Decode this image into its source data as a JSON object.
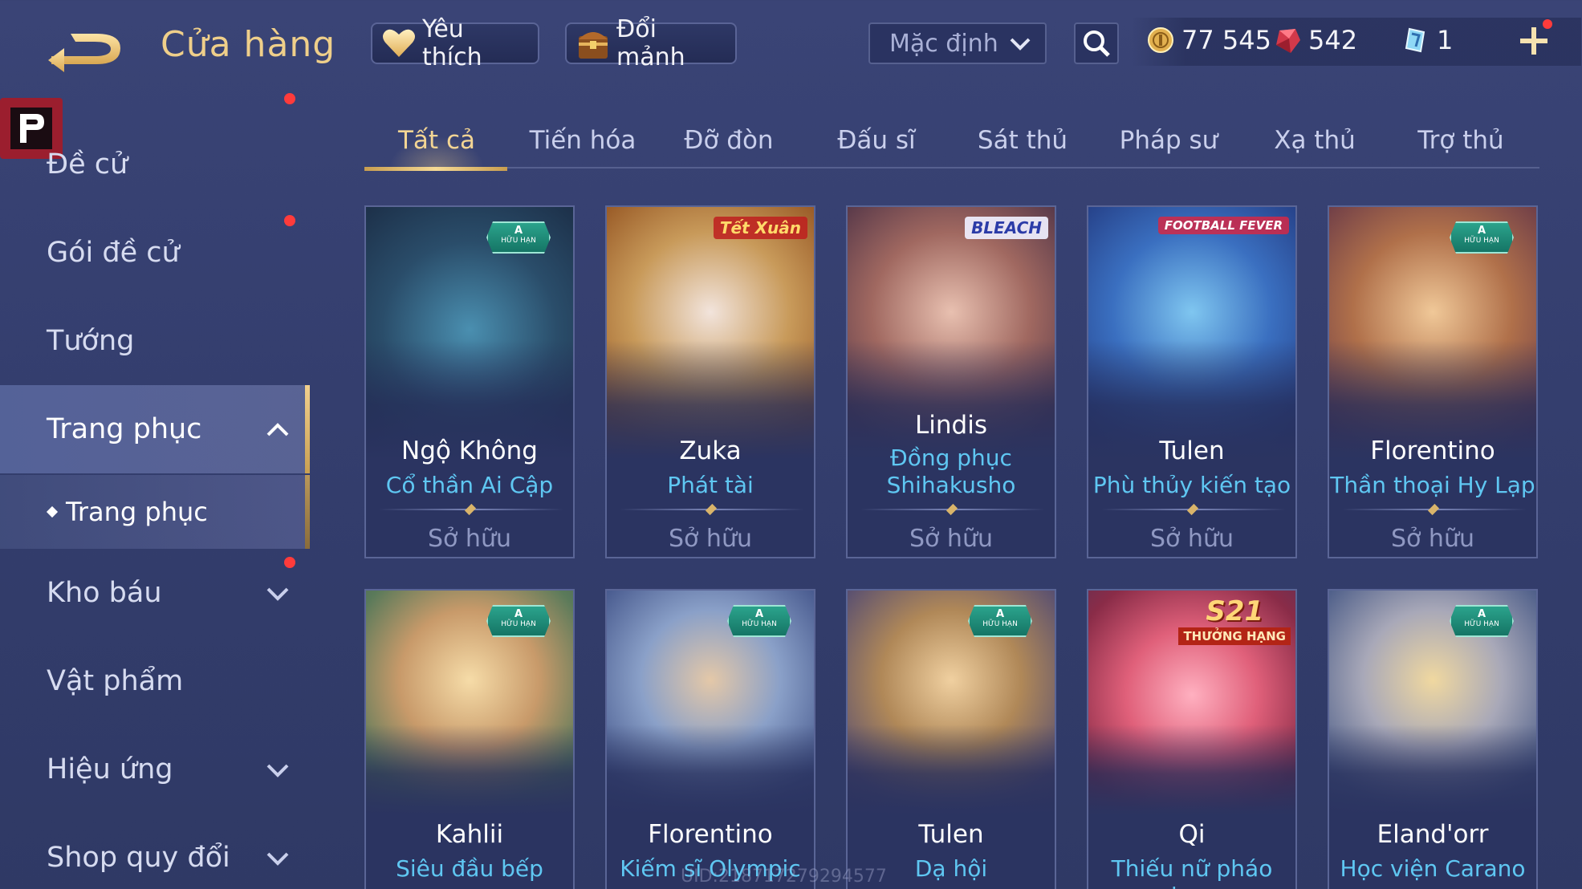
{
  "header": {
    "title": "Cửa hàng",
    "favorites_label": "Yêu thích",
    "swap_label": "Đổi mảnh",
    "sort_value": "Mặc định"
  },
  "currency": {
    "gold": "77 545",
    "ruby": "542",
    "ticket": "1"
  },
  "sidebar": {
    "items": [
      {
        "label": "Đề cử"
      },
      {
        "label": "Gói đề cử"
      },
      {
        "label": "Tướng"
      },
      {
        "label": "Trang phục"
      },
      {
        "label": "Trang phục"
      },
      {
        "label": "Kho báu"
      },
      {
        "label": "Vật phẩm"
      },
      {
        "label": "Hiệu ứng"
      },
      {
        "label": "Shop quy đổi"
      }
    ]
  },
  "tabs": [
    {
      "label": "Tất cả"
    },
    {
      "label": "Tiến hóa"
    },
    {
      "label": "Đỡ đòn"
    },
    {
      "label": "Đấu sĩ"
    },
    {
      "label": "Sát thủ"
    },
    {
      "label": "Pháp sư"
    },
    {
      "label": "Xạ thủ"
    },
    {
      "label": "Trợ thủ"
    }
  ],
  "badges": {
    "limited_tier": "A",
    "limited_label": "HỮU HẠN",
    "tet_label": "Tết Xuân",
    "bleach_label": "BLEACH",
    "football_label": "FOOTBALL FEVER",
    "season_label": "S21",
    "rank_label": "THƯỞNG HẠNG"
  },
  "cards": [
    {
      "hero": "Ngộ Không",
      "skin": "Cổ thần Ai Cập",
      "status": "Sở hữu"
    },
    {
      "hero": "Zuka",
      "skin": "Phát tài",
      "status": "Sở hữu"
    },
    {
      "hero": "Lindis",
      "skin": "Đồng phục Shihakusho",
      "status": "Sở hữu"
    },
    {
      "hero": "Tulen",
      "skin": "Phù thủy kiến tạo",
      "status": "Sở hữu"
    },
    {
      "hero": "Florentino",
      "skin": "Thần thoại Hy Lạp",
      "status": "Sở hữu"
    },
    {
      "hero": "Kahlii",
      "skin": "Siêu đầu bếp"
    },
    {
      "hero": "Florentino",
      "skin": "Kiếm sĩ Olympic"
    },
    {
      "hero": "Tulen",
      "skin": "Dạ hội"
    },
    {
      "hero": "Qi",
      "skin": "Thiếu nữ pháo hoa"
    },
    {
      "hero": "Eland'orr",
      "skin": "Học viện Carano"
    }
  ],
  "footer": {
    "uid": "UID:218717279294577"
  },
  "colors": {
    "background": "#343e6e",
    "gold_accent": "#f3d594",
    "skin_name": "#5fc7f2",
    "notification": "#ff3b3b"
  },
  "icons": {
    "back": "back-arrow-icon",
    "favorites": "heart-icon",
    "swap": "treasure-chest-icon",
    "sort": "chevron-down-icon",
    "search": "search-icon",
    "gold": "gold-coin-icon",
    "ruby": "ruby-gem-icon",
    "ticket": "crystal-ticket-icon",
    "add": "plus-icon"
  }
}
